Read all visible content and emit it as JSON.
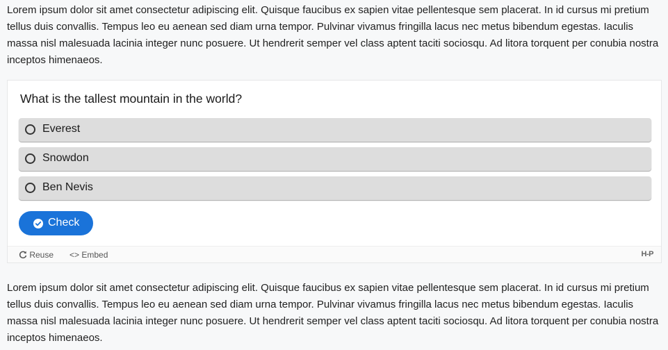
{
  "content": {
    "paragraph_top": "Lorem ipsum dolor sit amet consectetur adipiscing elit. Quisque faucibus ex sapien vitae pellentesque sem placerat. In id cursus mi pretium tellus duis convallis. Tempus leo eu aenean sed diam urna tempor. Pulvinar vivamus fringilla lacus nec metus bibendum egestas. Iaculis massa nisl malesuada lacinia integer nunc posuere. Ut hendrerit semper vel class aptent taciti sociosqu. Ad litora torquent per conubia nostra inceptos himenaeos.",
    "paragraph_bottom": "Lorem ipsum dolor sit amet consectetur adipiscing elit. Quisque faucibus ex sapien vitae pellentesque sem placerat. In id cursus mi pretium tellus duis convallis. Tempus leo eu aenean sed diam urna tempor. Pulvinar vivamus fringilla lacus nec metus bibendum egestas. Iaculis massa nisl malesuada lacinia integer nunc posuere. Ut hendrerit semper vel class aptent taciti sociosqu. Ad litora torquent per conubia nostra inceptos himenaeos."
  },
  "quiz": {
    "question": "What is the tallest mountain in the world?",
    "answers": [
      {
        "label": "Everest",
        "selected": false
      },
      {
        "label": "Snowdon",
        "selected": false
      },
      {
        "label": "Ben Nevis",
        "selected": false
      }
    ],
    "check_label": "Check",
    "check_icon": "check-circle-icon"
  },
  "footer": {
    "reuse_label": "Reuse",
    "reuse_icon": "refresh-icon",
    "embed_label": "Embed",
    "embed_icon": "code-icon",
    "logo_text": "H-P"
  },
  "colors": {
    "accent": "#1a73d9",
    "answer_bg": "#dddddd",
    "page_bg": "#f7f8f9"
  }
}
